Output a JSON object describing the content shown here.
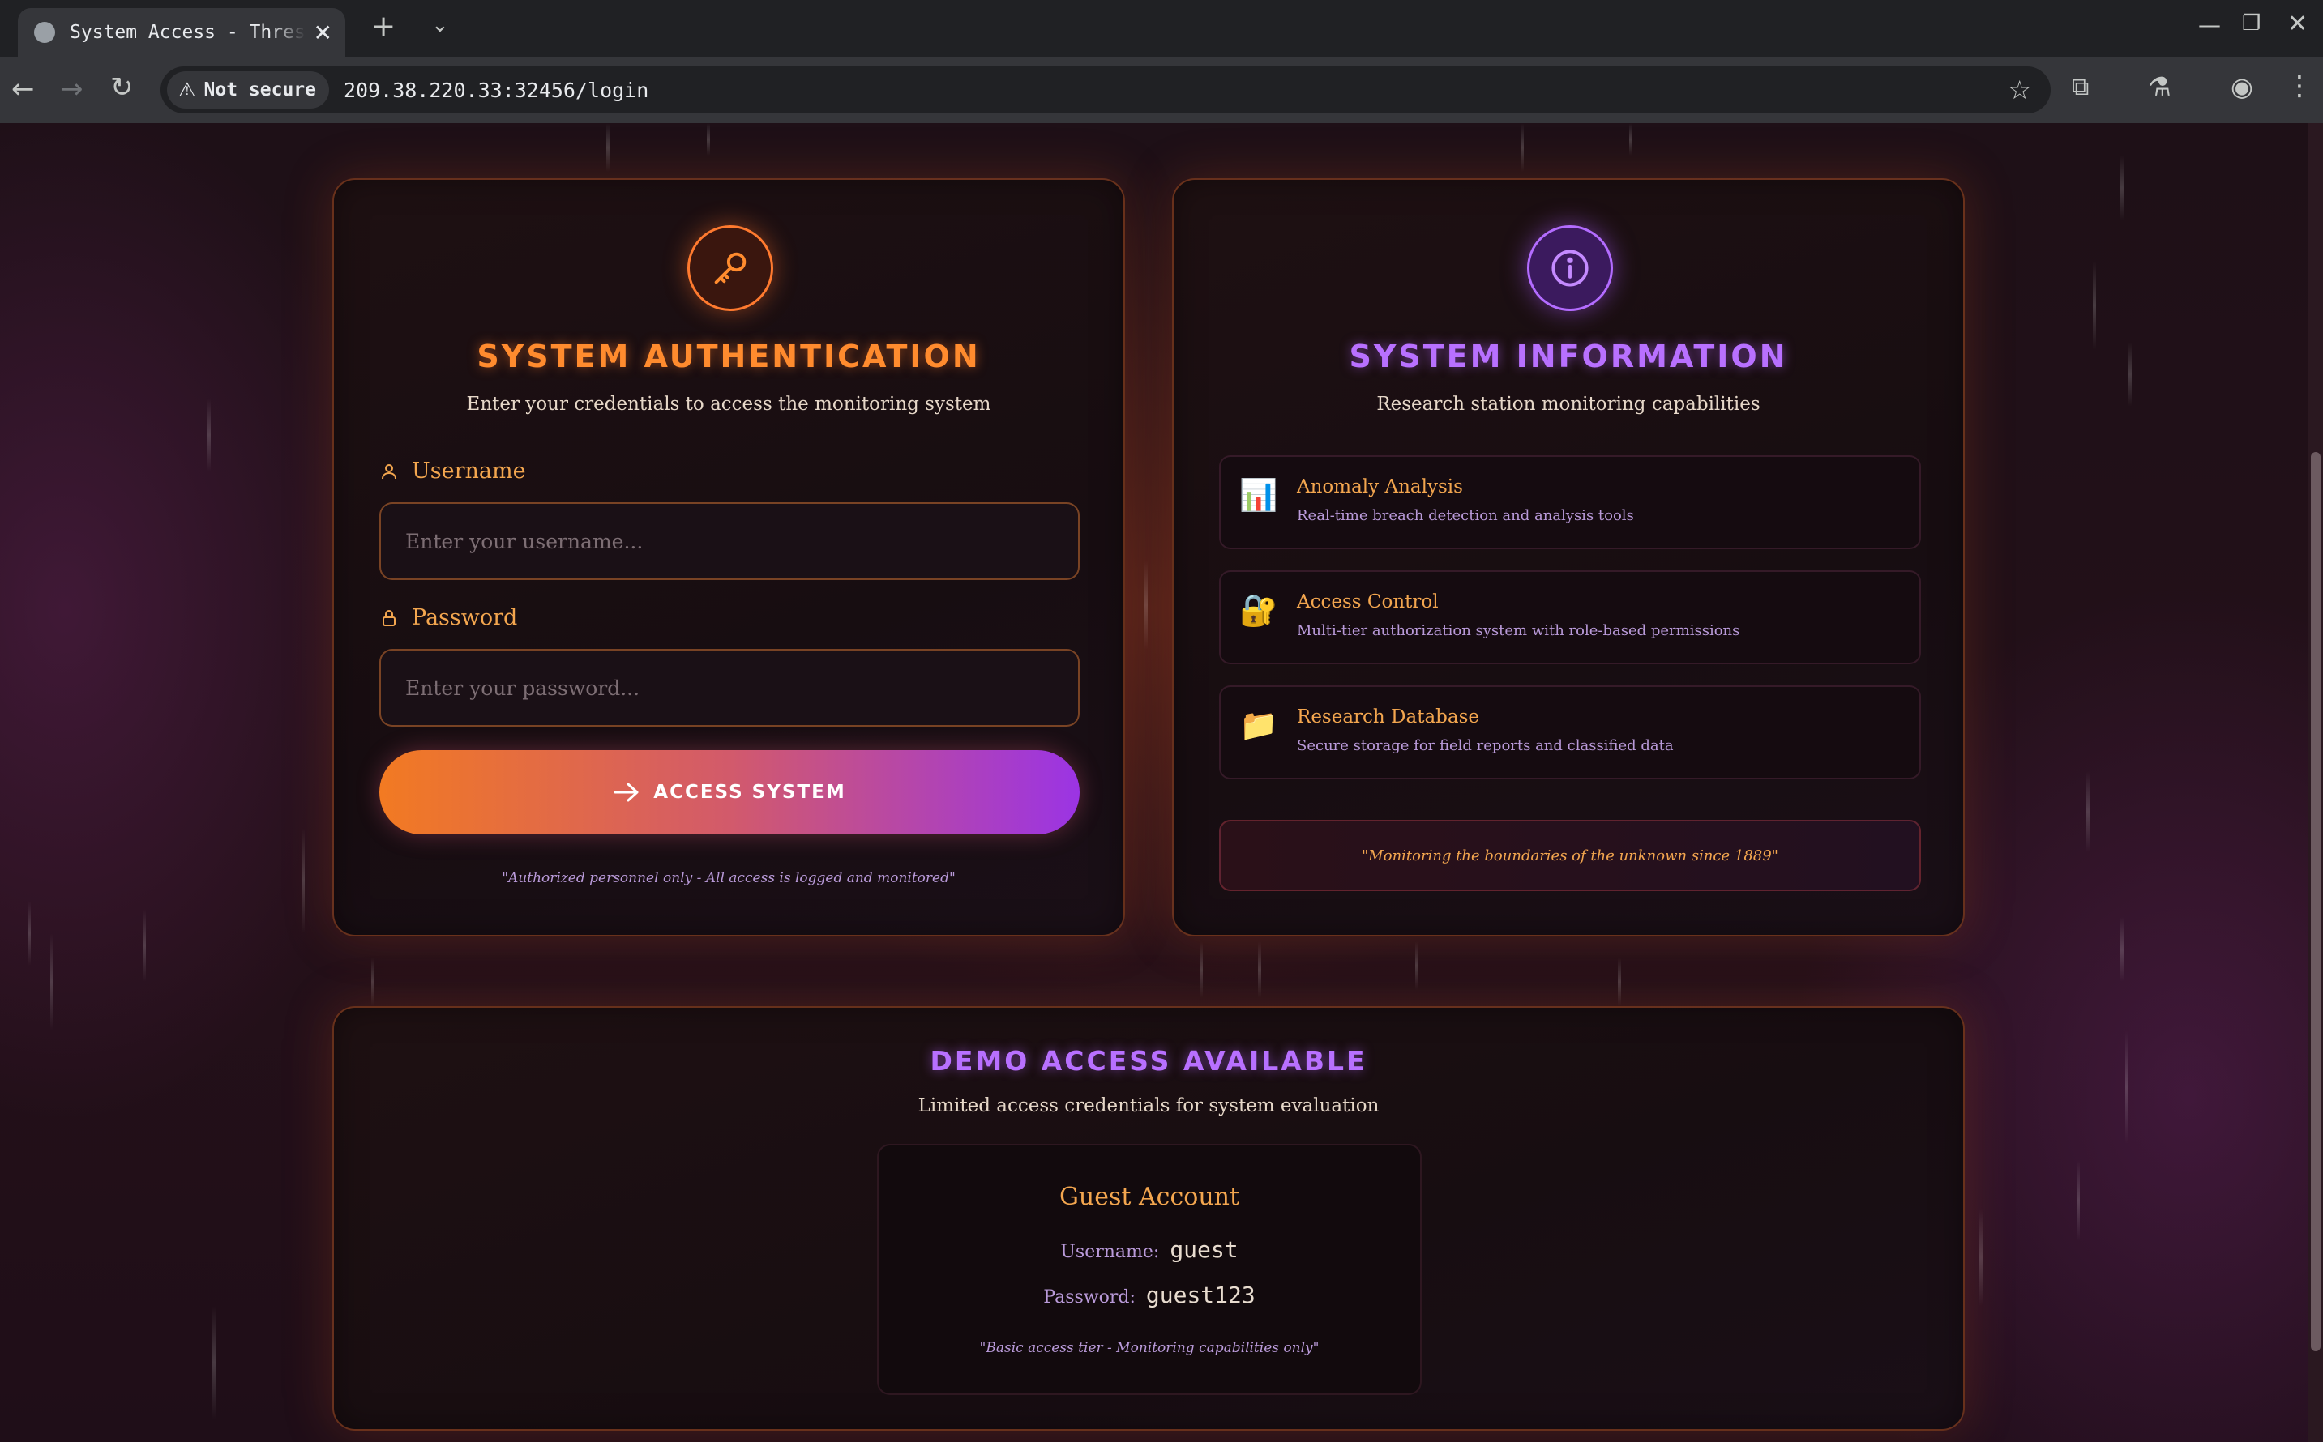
{
  "browser": {
    "tab_title": "System Access - Threshold",
    "security_label": "Not secure",
    "url": "209.38.220.33:32456/login"
  },
  "auth": {
    "title": "System Authentication",
    "subtitle": "Enter your credentials to access the monitoring system",
    "username_label": "Username",
    "username_placeholder": "Enter your username...",
    "password_label": "Password",
    "password_placeholder": "Enter your password...",
    "submit_label": "Access System",
    "footer_note": "\"Authorized personnel only - All access is logged and monitored\""
  },
  "info": {
    "title": "System Information",
    "subtitle": "Research station monitoring capabilities",
    "features": [
      {
        "icon": "📊",
        "title": "Anomaly Analysis",
        "description": "Real-time breach detection and analysis tools"
      },
      {
        "icon": "🔐",
        "title": "Access Control",
        "description": "Multi-tier authorization system with role-based permissions"
      },
      {
        "icon": "📁",
        "title": "Research Database",
        "description": "Secure storage for field reports and classified data"
      }
    ],
    "quote": "\"Monitoring the boundaries of the unknown since 1889\""
  },
  "demo": {
    "title": "Demo Access Available",
    "subtitle": "Limited access credentials for system evaluation",
    "account_title": "Guest Account",
    "username_label": "Username:",
    "username_value": "guest",
    "password_label": "Password:",
    "password_value": "guest123",
    "note": "\"Basic access tier - Monitoring capabilities only\""
  }
}
